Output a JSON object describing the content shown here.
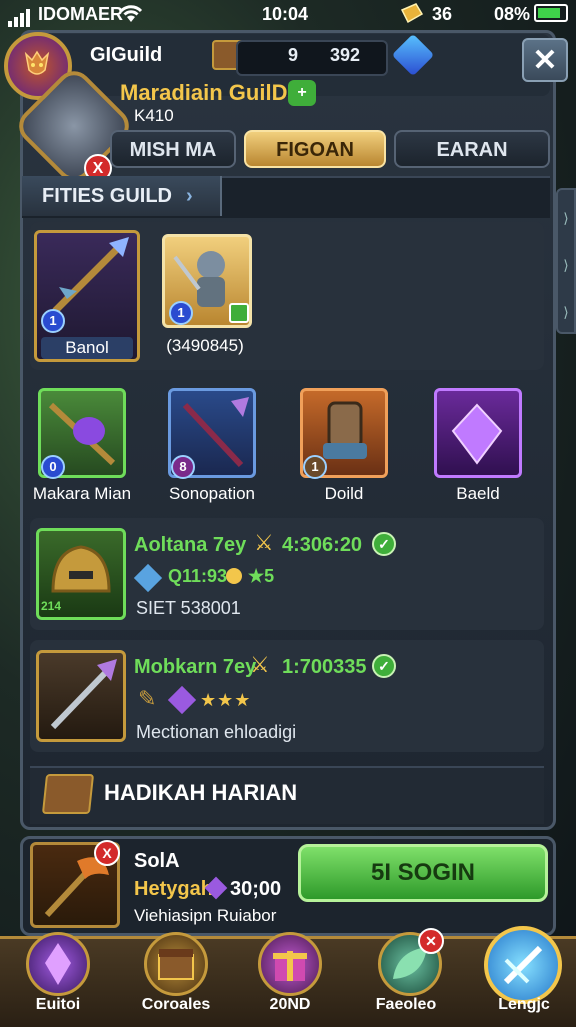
{
  "status": {
    "carrier": "IDOMAER",
    "time": "10:04",
    "gold": "36",
    "battery": "08%"
  },
  "header": {
    "guild_label": "GIGuild",
    "count_a": "9",
    "count_b": "392",
    "close_glyph": "✕"
  },
  "guild": {
    "name": "Maradiain GuilD",
    "id": "K410",
    "badge_glyph": "X"
  },
  "tabs": [
    {
      "label": "MISH MA",
      "active": false
    },
    {
      "label": "FIGOAN",
      "active": true
    },
    {
      "label": "EARAN",
      "active": false
    }
  ],
  "section": {
    "title": "FITIES GUILD",
    "chevron": "›"
  },
  "featured": [
    {
      "caption": "Banol",
      "badge": "1",
      "icon": "spear-icon"
    },
    {
      "caption": "(3490845)",
      "badge": "1",
      "icon": "knight-icon"
    }
  ],
  "items": [
    {
      "caption": "Makara Mian",
      "badge": "0",
      "icon": "staff-icon"
    },
    {
      "caption": "Sonopation",
      "badge": "8",
      "icon": "wand-icon"
    },
    {
      "caption": "Doild",
      "badge": "1",
      "icon": "barrel-icon"
    },
    {
      "caption": "Baeld",
      "badge": "",
      "icon": "crystal-icon"
    }
  ],
  "rows": [
    {
      "title": "Aoltana 7ey",
      "value": "4:306:20",
      "gem_value": "Q11:93",
      "stars": "★5",
      "sub": "SIET 538001",
      "thumb_badge": "214"
    },
    {
      "title": "Mobkarn 7ey",
      "value": "1:700335",
      "stars": "★★★",
      "sub": "Mectionan ehloadigi",
      "thumb_badge": ""
    }
  ],
  "daily": {
    "label": "HADIKAH HARIAN"
  },
  "reward": {
    "line1": "SolA",
    "line2a": "Hetygah",
    "line2b": "30;00",
    "line3": "Viehiasipn Ruiabor",
    "x_glyph": "X",
    "button": "5I SOGIN"
  },
  "nav": [
    {
      "label": "Euitoi",
      "icon": "crystal-shard-icon"
    },
    {
      "label": "Coroales",
      "icon": "chest-icon"
    },
    {
      "label": "20ND",
      "icon": "gift-icon"
    },
    {
      "label": "Faeoleo",
      "icon": "leaf-icon"
    },
    {
      "label": "Lengjc",
      "icon": "sword-icon"
    }
  ],
  "colors": {
    "accent_gold": "#f3c64b",
    "accent_green": "#6fdd5a",
    "panel": "#28313c"
  }
}
